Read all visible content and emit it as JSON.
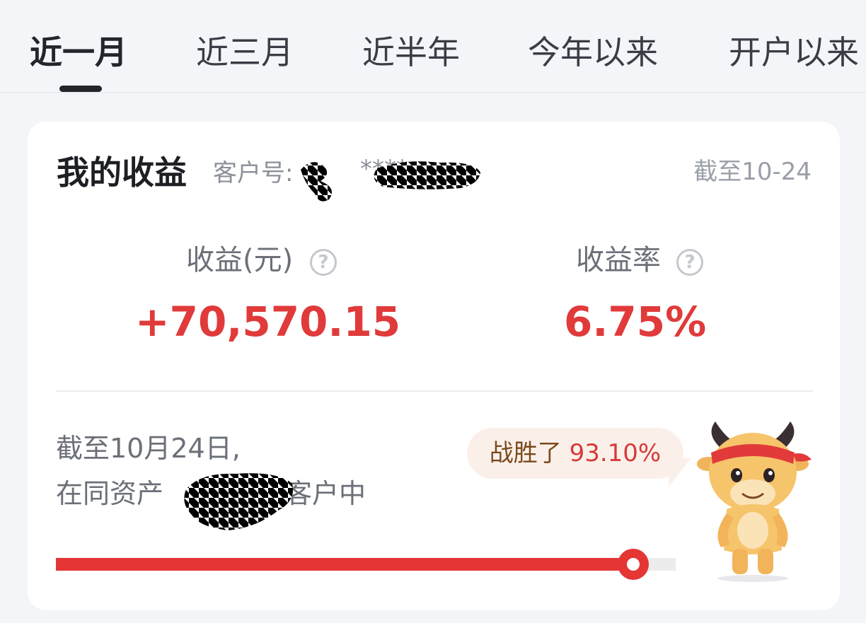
{
  "tabs": [
    {
      "label": "近一月",
      "active": true
    },
    {
      "label": "近三月",
      "active": false
    },
    {
      "label": "近半年",
      "active": false
    },
    {
      "label": "今年以来",
      "active": false
    },
    {
      "label": "开户以来",
      "active": false
    }
  ],
  "card": {
    "title": "我的收益",
    "account_label": "客户号:",
    "account_masked": "****",
    "as_of": "截至10-24"
  },
  "metrics": {
    "profit_label": "收益(元)",
    "profit_value": "+70,570.15",
    "rate_label": "收益率",
    "rate_value": "6.75%"
  },
  "ranking": {
    "line1": "截至10月24日,",
    "line2_prefix": "在同资产",
    "line2_suffix": "客户中",
    "bubble_text": "战胜了",
    "bubble_percent": "93.10%",
    "progress_fraction": 0.931
  },
  "colors": {
    "accent_red": "#e53535",
    "value_red": "#e03a3a",
    "bubble_bg": "#fbf0e9"
  },
  "icons": {
    "help": "question-circle-icon",
    "mascot": "ox-mascot"
  }
}
